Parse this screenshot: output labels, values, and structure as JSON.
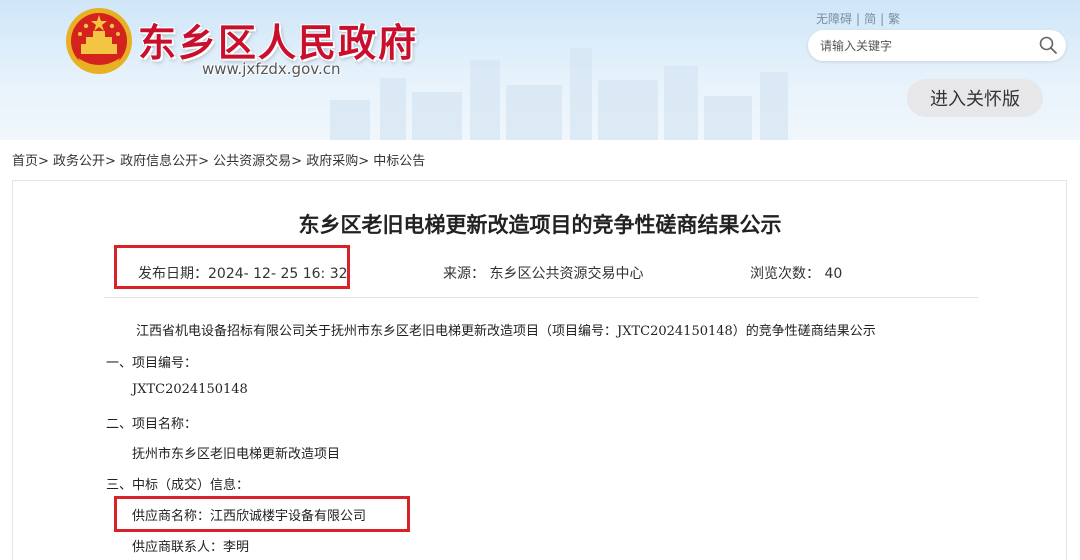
{
  "header": {
    "site_title": "东乡区人民政府",
    "site_url": "www.jxfzdx.gov.cn",
    "top_links": [
      "无障碍",
      "简",
      "繁"
    ],
    "search_placeholder": "请输入关键字",
    "care_button": "进入关怀版"
  },
  "breadcrumb": [
    "首页>",
    "政务公开>",
    "政府信息公开>",
    "公共资源交易>",
    "政府采购>",
    "中标公告"
  ],
  "article": {
    "title": "东乡区老旧电梯更新改造项目的竞争性磋商结果公示",
    "publish_date": "发布日期：2024- 12- 25 16: 32",
    "source": "来源：  东乡区公共资源交易中心",
    "views": "浏览次数：  40",
    "intro": "江西省机电设备招标有限公司关于抚州市东乡区老旧电梯更新改造项目（项目编号：JXTC2024150148）的竞争性磋商结果公示",
    "sections": [
      "一、项目编号：",
      "JXTC2024150148",
      "二、项目名称：",
      "抚州市东乡区老旧电梯更新改造项目",
      "三、中标（成交）信息：",
      "供应商名称：江西欣诚楼宇设备有限公司",
      "供应商联系人：李明"
    ]
  },
  "colors": {
    "title_red": "#c8102e",
    "highlight_red": "#d8222a",
    "banner_blue": "#cfe6f8"
  }
}
